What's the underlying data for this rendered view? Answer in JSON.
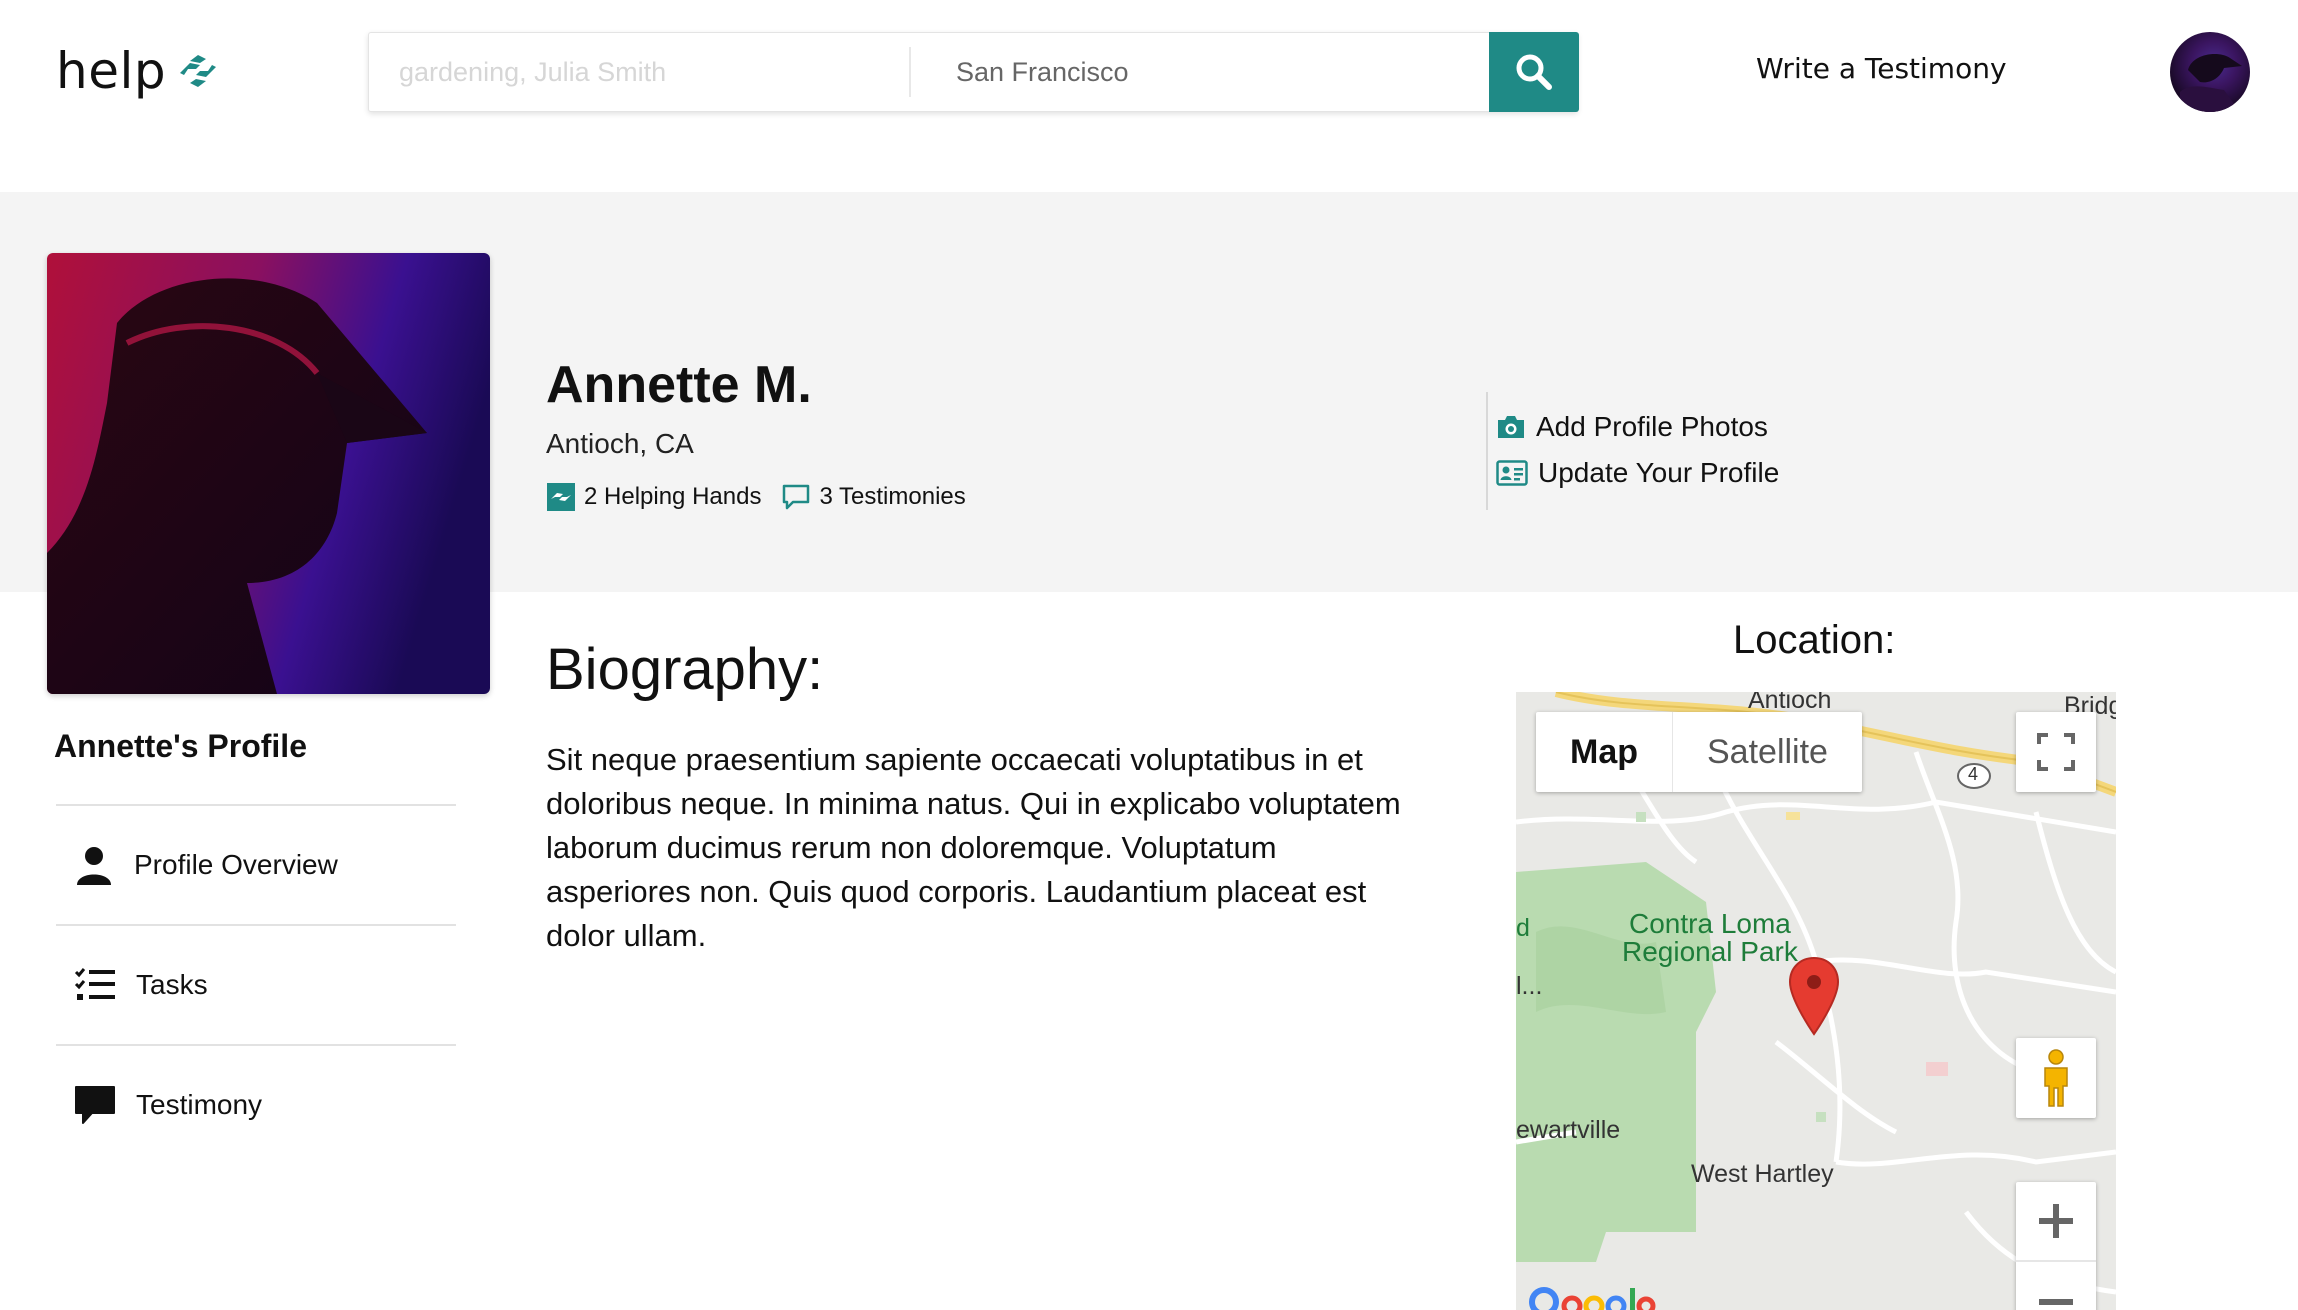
{
  "header": {
    "logo_text": "help",
    "search": {
      "what_placeholder": "gardening, Julia Smith",
      "where_value": "San Francisco"
    },
    "write_testimony_label": "Write a Testimony",
    "brand_color": "#1f8a86"
  },
  "profile": {
    "name": "Annette M.",
    "location": "Antioch, CA",
    "helping_hands": "2 Helping Hands",
    "testimonies": "3 Testimonies",
    "actions": {
      "add_photos": "Add Profile Photos",
      "update_profile": "Update Your Profile"
    }
  },
  "sidebar": {
    "title": "Annette's Profile",
    "items": [
      {
        "label": "Profile Overview",
        "icon": "user-icon"
      },
      {
        "label": "Tasks",
        "icon": "task-list-icon"
      },
      {
        "label": "Testimony",
        "icon": "chat-bubble-icon"
      }
    ]
  },
  "biography": {
    "heading": "Biography:",
    "text": "Sit neque praesentium sapiente occaecati voluptatibus in et doloribus neque. In minima natus. Qui in explicabo voluptatem laborum ducimus rerum non doloremque. Voluptatum asperiores non. Quis quod corporis. Laudantium placeat est dolor ullam."
  },
  "location": {
    "heading": "Location:",
    "map": {
      "type_map": "Map",
      "type_satellite": "Satellite",
      "labels": {
        "antioch": "Antioch",
        "bridge": "Bridg",
        "park_line1": "Contra Loma",
        "park_line2": "Regional Park",
        "stewartville": "ewartville",
        "west_hartley": "West Hartley",
        "left_d": "d",
        "left_l": "l...",
        "route": "4"
      }
    }
  }
}
